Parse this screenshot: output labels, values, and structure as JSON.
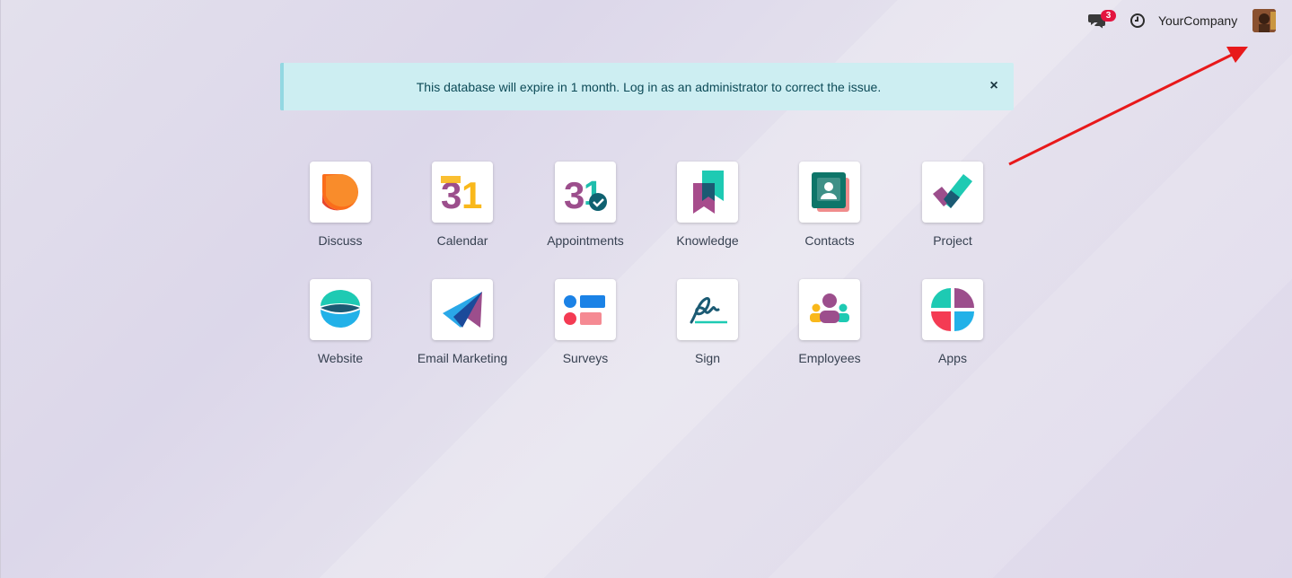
{
  "topbar": {
    "chat_icon": "chat-icon",
    "chat_badge": "3",
    "clock_icon": "clock-icon",
    "company_name": "YourCompany",
    "avatar_icon": "user-avatar"
  },
  "alert": {
    "message": "This database will expire in 1 month. Log in as an administrator to correct the issue.",
    "close_label": "×"
  },
  "apps": [
    {
      "label": "Discuss",
      "icon": "discuss-icon"
    },
    {
      "label": "Calendar",
      "icon": "calendar-icon"
    },
    {
      "label": "Appointments",
      "icon": "appointments-icon"
    },
    {
      "label": "Knowledge",
      "icon": "knowledge-icon"
    },
    {
      "label": "Contacts",
      "icon": "contacts-icon"
    },
    {
      "label": "Project",
      "icon": "project-icon"
    },
    {
      "label": "Website",
      "icon": "website-icon"
    },
    {
      "label": "Email Marketing",
      "icon": "email-marketing-icon"
    },
    {
      "label": "Surveys",
      "icon": "surveys-icon"
    },
    {
      "label": "Sign",
      "icon": "sign-icon"
    },
    {
      "label": "Employees",
      "icon": "employees-icon"
    },
    {
      "label": "Apps",
      "icon": "apps-icon"
    }
  ],
  "colors": {
    "badge": "#e3143f",
    "alert_bg": "#cdeef2",
    "alert_text": "#0c4a57",
    "annotation_arrow": "#e8191b"
  }
}
